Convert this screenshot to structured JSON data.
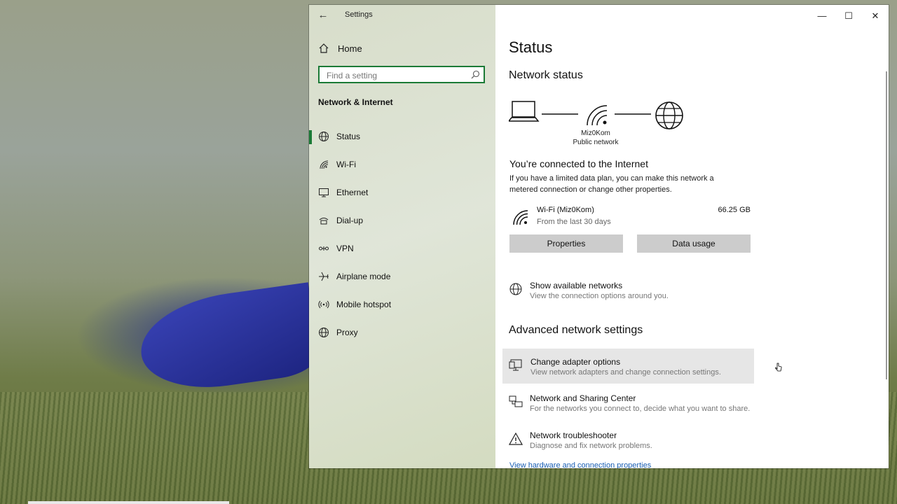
{
  "window": {
    "title": "Settings",
    "back": "←",
    "minimize": "—",
    "maximize": "☐",
    "close": "✕"
  },
  "sidebar": {
    "home_label": "Home",
    "search_placeholder": "Find a setting",
    "section_heading": "Network & Internet",
    "items": [
      {
        "label": "Status",
        "icon": "globe-icon",
        "active": true
      },
      {
        "label": "Wi-Fi",
        "icon": "wifi-icon"
      },
      {
        "label": "Ethernet",
        "icon": "ethernet-icon"
      },
      {
        "label": "Dial-up",
        "icon": "dialup-icon"
      },
      {
        "label": "VPN",
        "icon": "vpn-icon"
      },
      {
        "label": "Airplane mode",
        "icon": "airplane-icon"
      },
      {
        "label": "Mobile hotspot",
        "icon": "hotspot-icon"
      },
      {
        "label": "Proxy",
        "icon": "proxy-globe-icon"
      }
    ]
  },
  "main": {
    "title": "Status",
    "network_status_heading": "Network status",
    "network_name": "Miz0Kom",
    "network_type": "Public network",
    "connected_title": "You’re connected to the Internet",
    "connected_desc": "If you have a limited data plan, you can make this network a metered connection or change other properties.",
    "wifi": {
      "name": "Wi-Fi (Miz0Kom)",
      "period": "From the last 30 days",
      "usage": "66.25 GB"
    },
    "buttons": {
      "properties": "Properties",
      "data_usage": "Data usage"
    },
    "show_networks": {
      "title": "Show available networks",
      "desc": "View the connection options around you."
    },
    "advanced_heading": "Advanced network settings",
    "advanced": [
      {
        "title": "Change adapter options",
        "desc": "View network adapters and change connection settings.",
        "icon": "monitor-adapter-icon"
      },
      {
        "title": "Network and Sharing Center",
        "desc": "For the networks you connect to, decide what you want to share.",
        "icon": "sharing-center-icon"
      },
      {
        "title": "Network troubleshooter",
        "desc": "Diagnose and fix network problems.",
        "icon": "warning-triangle-icon"
      }
    ],
    "hardware_link": "View hardware and connection properties"
  },
  "colors": {
    "accent": "#1b7a36",
    "link": "#1a5fb4",
    "button_bg": "#cccccc",
    "hover_bg": "#e6e6e6"
  }
}
